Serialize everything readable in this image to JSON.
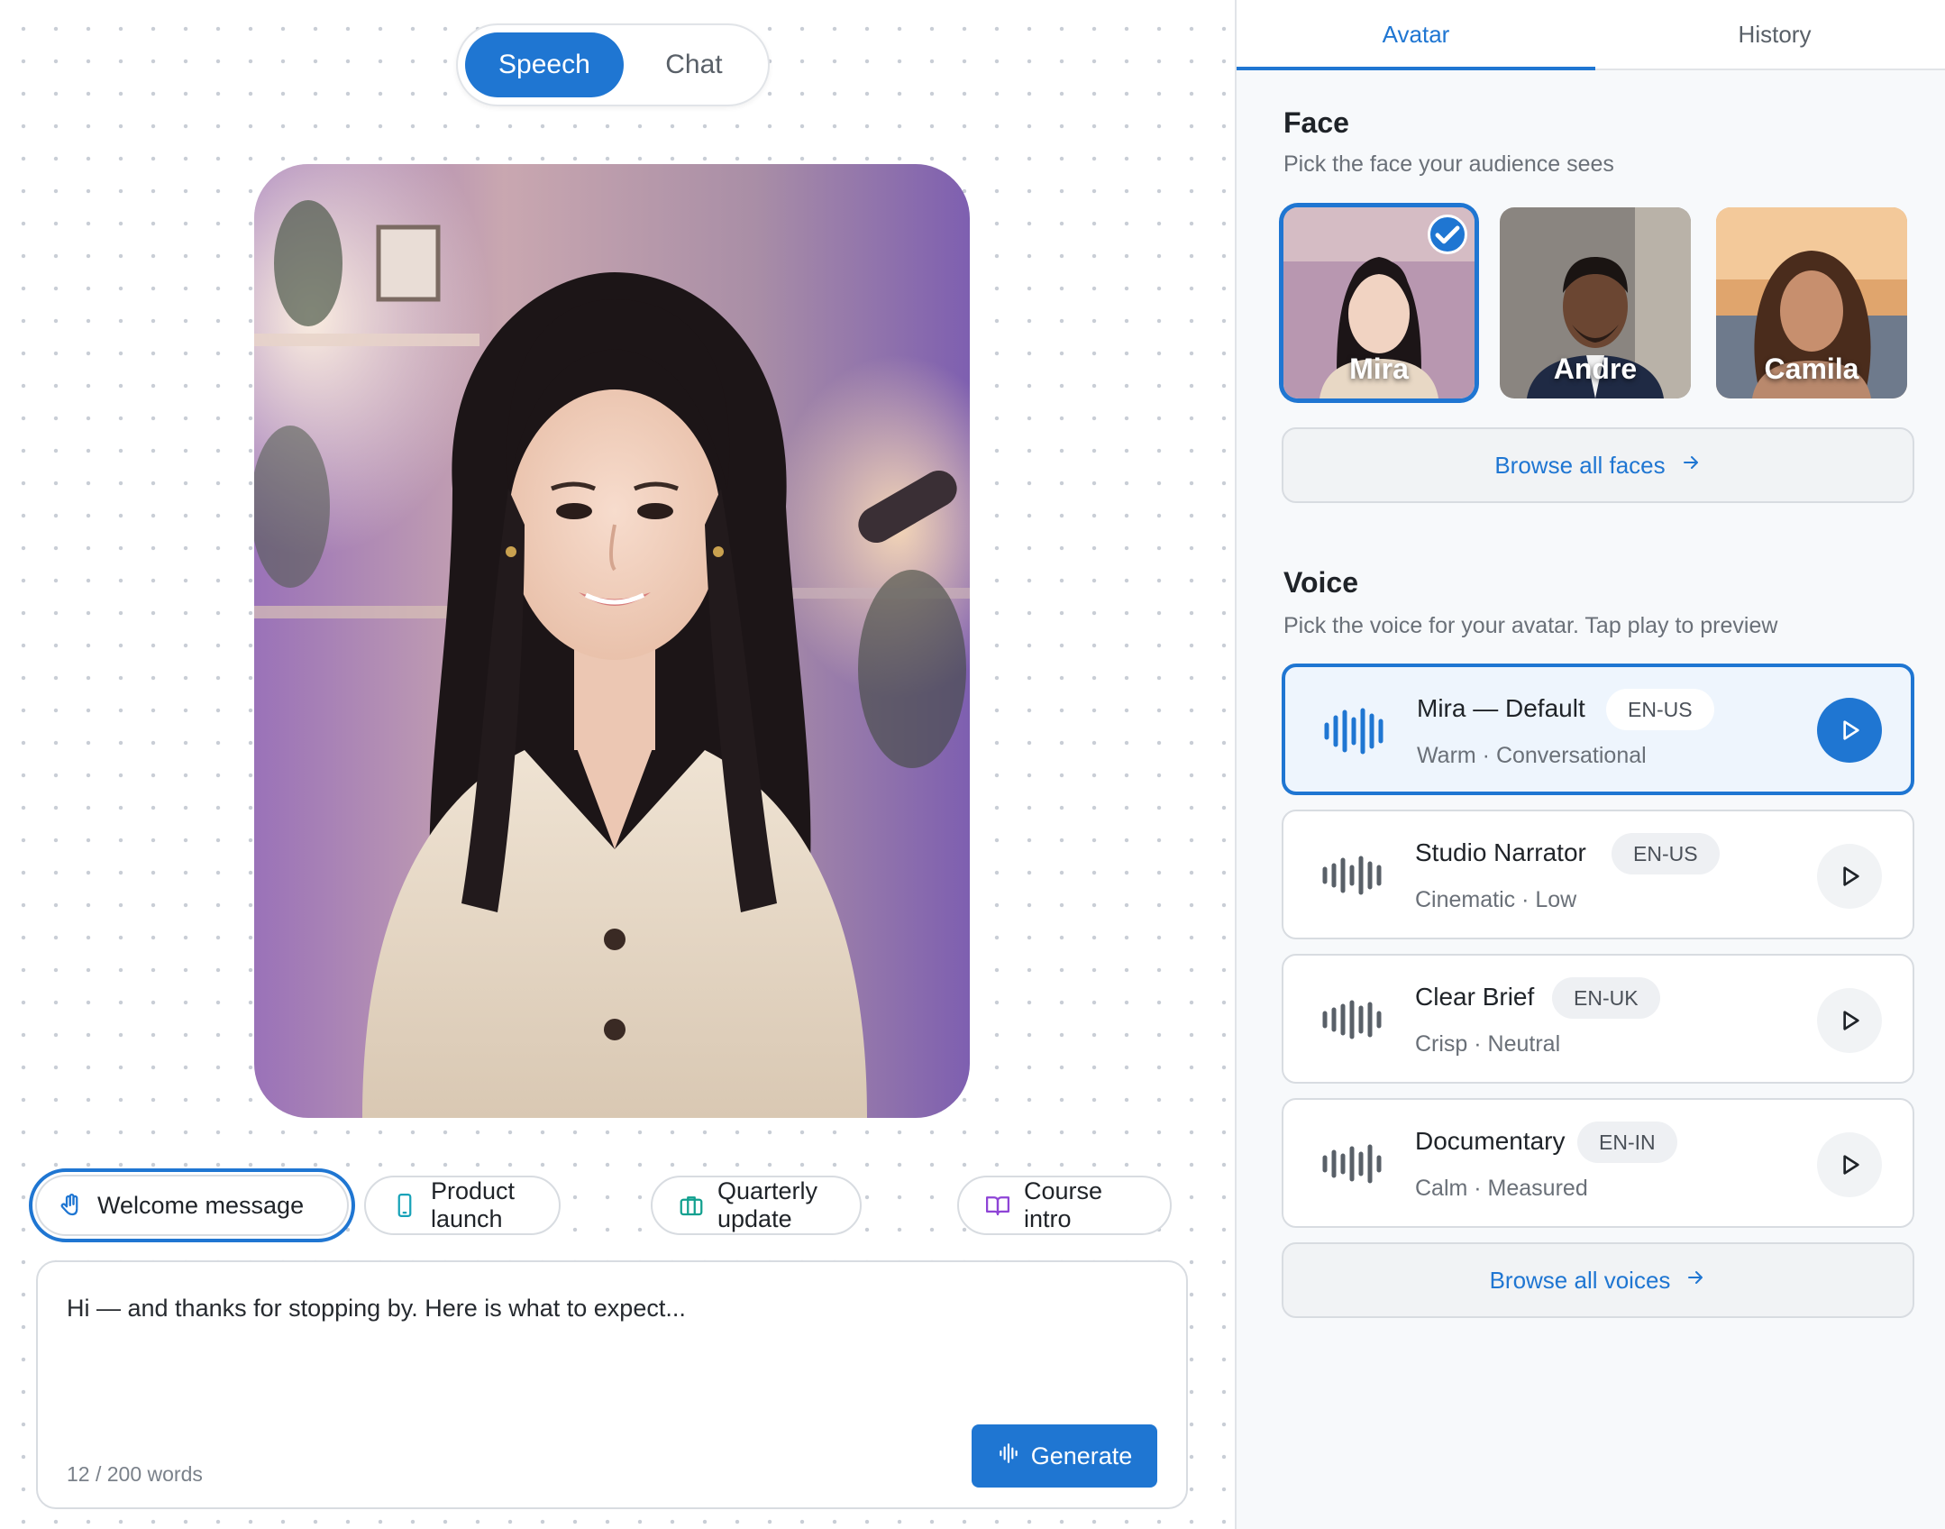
{
  "mode_toggle": {
    "active": "Speech",
    "inactive": "Chat"
  },
  "presets": [
    {
      "label": "Welcome message",
      "icon": "hand-wave-icon",
      "selected": true
    },
    {
      "label": "Product launch",
      "icon": "phone-icon",
      "selected": false
    },
    {
      "label": "Quarterly update",
      "icon": "briefcase-icon",
      "selected": false
    },
    {
      "label": "Course intro",
      "icon": "book-open-icon",
      "selected": false
    }
  ],
  "script": {
    "text": "Hi — and thanks for stopping by. Here is what to expect...",
    "word_count": "12 / 200 words",
    "generate_label": "Generate"
  },
  "panel": {
    "tabs": {
      "avatar": "Avatar",
      "history": "History"
    },
    "face": {
      "title": "Face",
      "subtitle": "Pick the face your audience sees",
      "items": [
        {
          "name": "Mira",
          "selected": true
        },
        {
          "name": "Andre",
          "selected": false
        },
        {
          "name": "Camila",
          "selected": false
        }
      ],
      "browse_label": "Browse all faces"
    },
    "voice": {
      "title": "Voice",
      "subtitle": "Pick the voice for your avatar. Tap play to preview",
      "items": [
        {
          "name": "Mira — Default",
          "locale": "EN-US",
          "description": "Warm · Conversational",
          "selected": true
        },
        {
          "name": "Studio Narrator",
          "locale": "EN-US",
          "description": "Cinematic · Low",
          "selected": false
        },
        {
          "name": "Clear Brief",
          "locale": "EN-UK",
          "description": "Crisp · Neutral",
          "selected": false
        },
        {
          "name": "Documentary",
          "locale": "EN-IN",
          "description": "Calm · Measured",
          "selected": false
        }
      ],
      "browse_label": "Browse all voices"
    }
  },
  "colors": {
    "accent": "#1f76d2",
    "panel_bg": "#f7f9fb",
    "border": "#d8dce1"
  }
}
